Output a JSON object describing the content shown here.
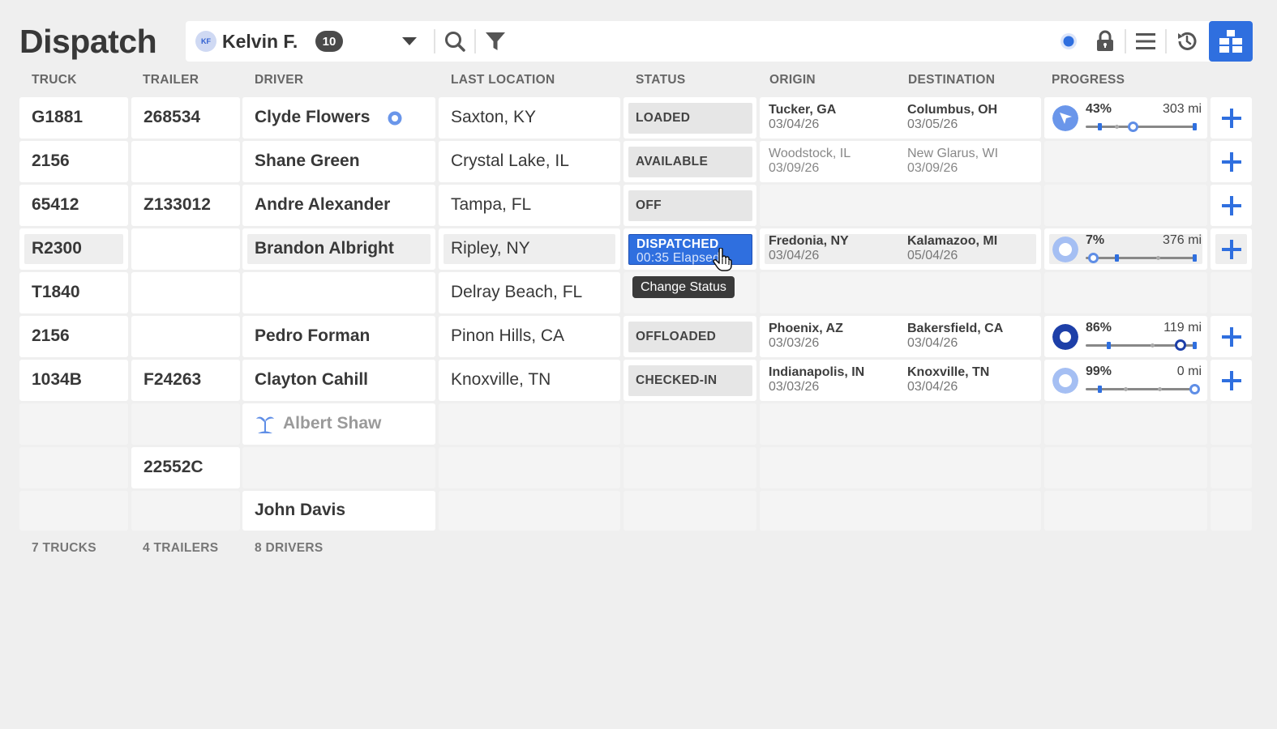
{
  "app": {
    "title": "Dispatch"
  },
  "toolbar": {
    "avatar_initials": "KF",
    "user_name": "Kelvin F.",
    "count_badge": "10",
    "icons": [
      "chevron-down-icon",
      "search-icon",
      "filter-icon",
      "status-dot-icon",
      "lock-icon",
      "list-icon",
      "history-icon",
      "grid-view-icon"
    ],
    "accent_color": "#2f6fdf"
  },
  "columns": [
    "TRUCK",
    "TRAILER",
    "DRIVER",
    "LAST LOCATION",
    "STATUS",
    "ORIGIN",
    "DESTINATION",
    "PROGRESS"
  ],
  "rows": [
    {
      "truck": "G1881",
      "trailer": "268534",
      "driver": "Clyde Flowers",
      "driver_indicator": "active-dot-icon",
      "location": "Saxton, KY",
      "status": "LOADED",
      "origin": {
        "city": "Tucker, GA",
        "date": "03/04/26"
      },
      "destination": {
        "city": "Columbus, OH",
        "date": "03/05/26"
      },
      "progress": {
        "percent": "43%",
        "value": 0.43,
        "remaining": "303 mi",
        "icon": "navigation-arrow-icon"
      }
    },
    {
      "truck": "2156",
      "trailer": "",
      "driver": "Shane Green",
      "location": "Crystal Lake, IL",
      "status": "AVAILABLE",
      "origin": {
        "city": "Woodstock, IL",
        "date": "03/09/26"
      },
      "destination": {
        "city": "New Glarus, WI",
        "date": "03/09/26"
      }
    },
    {
      "truck": "65412",
      "trailer": "Z133012",
      "driver": "Andre Alexander",
      "location": "Tampa, FL",
      "status": "OFF"
    },
    {
      "truck": "R2300",
      "trailer": "",
      "driver": "Brandon Albright",
      "location": "Ripley, NY",
      "status": "DISPATCHED",
      "status_sub": "00:35 Elapsed",
      "origin": {
        "city": "Fredonia, NY",
        "date": "03/04/26"
      },
      "destination": {
        "city": "Kalamazoo, MI",
        "date": "05/04/26"
      },
      "progress": {
        "percent": "7%",
        "value": 0.07,
        "remaining": "376 mi",
        "icon": "progress-ring-icon"
      }
    },
    {
      "truck": "T1840",
      "trailer": "",
      "driver": "",
      "location": "Delray Beach, FL",
      "status": ""
    },
    {
      "truck": "2156",
      "trailer": "",
      "driver": "Pedro Forman",
      "location": "Pinon Hills, CA",
      "status": "OFFLOADED",
      "origin": {
        "city": "Phoenix, AZ",
        "date": "03/03/26"
      },
      "destination": {
        "city": "Bakersfield, CA",
        "date": "03/04/26"
      },
      "progress": {
        "percent": "86%",
        "value": 0.86,
        "remaining": "119 mi",
        "icon": "progress-ring-icon"
      }
    },
    {
      "truck": "1034B",
      "trailer": "F24263",
      "driver": "Clayton Cahill",
      "location": "Knoxville, TN",
      "status": "CHECKED-IN",
      "origin": {
        "city": "Indianapolis, IN",
        "date": "03/03/26"
      },
      "destination": {
        "city": "Knoxville, TN",
        "date": "03/04/26"
      },
      "progress": {
        "percent": "99%",
        "value": 0.99,
        "remaining": "0 mi",
        "icon": "progress-ring-icon"
      }
    },
    {
      "truck": "",
      "trailer": "",
      "driver": "Albert Shaw",
      "driver_indicator": "vacation-palm-icon"
    },
    {
      "truck": "",
      "trailer": "22552C",
      "driver": ""
    },
    {
      "truck": "",
      "trailer": "",
      "driver": "John Davis"
    }
  ],
  "tooltip": "Change Status",
  "footer": {
    "trucks": "7 TRUCKS",
    "trailers": "4 TRAILERS",
    "drivers": "8 DRIVERS"
  }
}
